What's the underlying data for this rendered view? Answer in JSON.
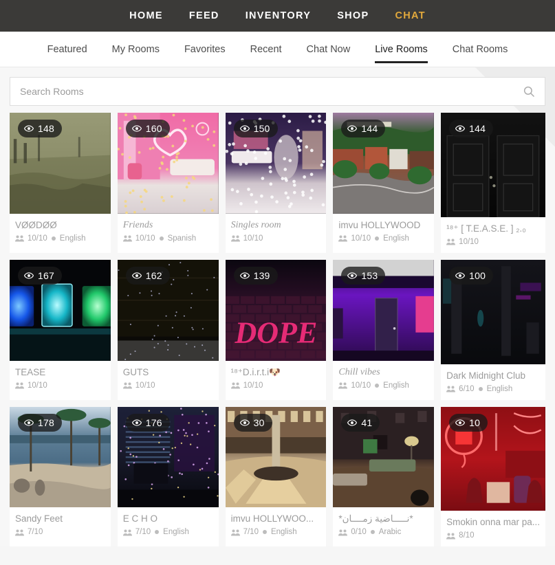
{
  "topnav": {
    "items": [
      {
        "label": "HOME",
        "active": false
      },
      {
        "label": "FEED",
        "active": false
      },
      {
        "label": "INVENTORY",
        "active": false
      },
      {
        "label": "SHOP",
        "active": false
      },
      {
        "label": "CHAT",
        "active": true
      }
    ],
    "active_color": "#e2a93c",
    "background": "#3b3a38"
  },
  "tabs": [
    {
      "label": "Featured",
      "active": false
    },
    {
      "label": "My Rooms",
      "active": false
    },
    {
      "label": "Favorites",
      "active": false
    },
    {
      "label": "Recent",
      "active": false
    },
    {
      "label": "Chat Now",
      "active": false
    },
    {
      "label": "Live Rooms",
      "active": true
    },
    {
      "label": "Chat Rooms",
      "active": false
    }
  ],
  "search": {
    "placeholder": "Search Rooms",
    "value": "",
    "icon": "search-icon"
  },
  "rooms": [
    {
      "title": "VØØDØØ",
      "viewers": "148",
      "capacity": "10/10",
      "language": "English",
      "style": "plain",
      "art": "swamp"
    },
    {
      "title": "Friends",
      "viewers": "160",
      "capacity": "10/10",
      "language": "Spanish",
      "style": "script",
      "art": "pinkroom"
    },
    {
      "title": "Singles room",
      "viewers": "150",
      "capacity": "10/10",
      "language": "",
      "style": "script",
      "art": "starry"
    },
    {
      "title": "imvu HOLLYWOOD",
      "viewers": "144",
      "capacity": "10/10",
      "language": "English",
      "style": "plain",
      "art": "hollywood"
    },
    {
      "title": "¹⁸⁺ [ T.E.A.S.E. ] ₂.₀",
      "viewers": "144",
      "capacity": "10/10",
      "language": "",
      "style": "plain",
      "art": "darkdoor"
    },
    {
      "title": "TEASE",
      "viewers": "167",
      "capacity": "10/10",
      "language": "",
      "style": "plain",
      "art": "neonpanels"
    },
    {
      "title": "GUTS",
      "viewers": "162",
      "capacity": "10/10",
      "language": "",
      "style": "plain",
      "art": "darkstars"
    },
    {
      "title": "¹⁸⁺D.i.r.t.i🐶",
      "viewers": "139",
      "capacity": "10/10",
      "language": "",
      "style": "plain",
      "art": "dope"
    },
    {
      "title": "Chill vibes",
      "viewers": "153",
      "capacity": "10/10",
      "language": "English",
      "style": "script",
      "art": "purpleroom"
    },
    {
      "title": "Dark Midnight Club",
      "viewers": "100",
      "capacity": "6/10",
      "language": "English",
      "style": "plain",
      "art": "gothic"
    },
    {
      "title": "Sandy Feet",
      "viewers": "178",
      "capacity": "7/10",
      "language": "",
      "style": "plain",
      "art": "beach"
    },
    {
      "title": "E C H O",
      "viewers": "176",
      "capacity": "7/10",
      "language": "English",
      "style": "plain",
      "art": "nightlounge"
    },
    {
      "title": "imvu HOLLYWOO...",
      "viewers": "30",
      "capacity": "7/10",
      "language": "English",
      "style": "plain",
      "art": "plaza"
    },
    {
      "title": "*نـــــاضية زمــــان*",
      "viewers": "41",
      "capacity": "0/10",
      "language": "Arabic",
      "style": "plain",
      "art": "alley"
    },
    {
      "title": "Smokin onna mar pa...",
      "viewers": "10",
      "capacity": "8/10",
      "language": "",
      "style": "plain",
      "art": "redneon"
    }
  ]
}
